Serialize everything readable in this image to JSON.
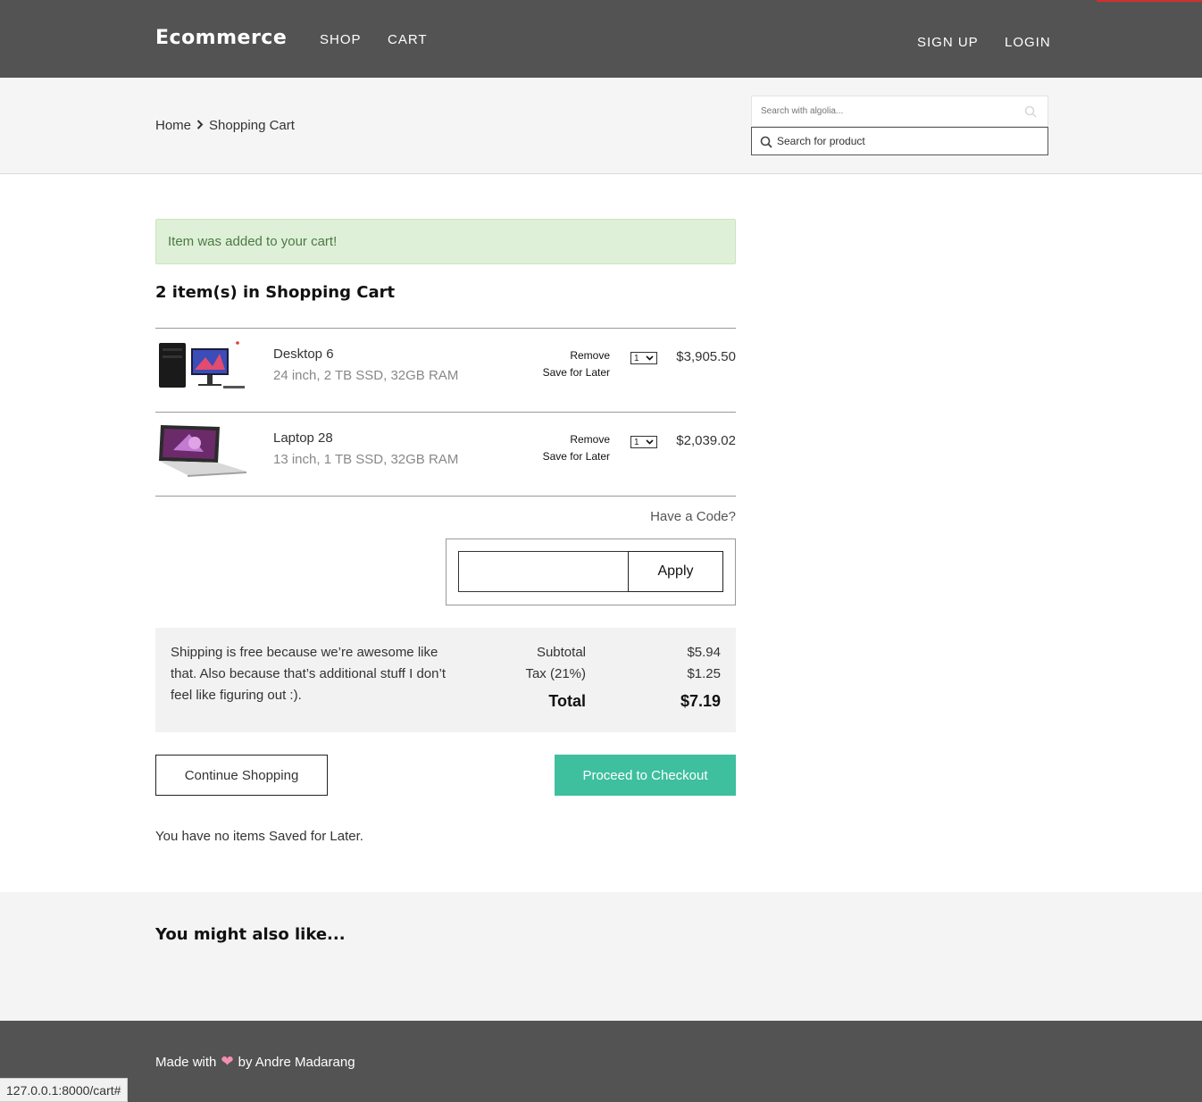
{
  "header": {
    "brand": "Ecommerce",
    "nav": {
      "shop": "SHOP",
      "cart": "CART",
      "signup": "SIGN UP",
      "login": "LOGIN"
    }
  },
  "breadcrumb": {
    "home": "Home",
    "current": "Shopping Cart"
  },
  "search": {
    "algolia_placeholder": "Search with algolia...",
    "product_placeholder": "Search for product"
  },
  "alert": "Item was added to your cart!",
  "cart": {
    "heading": "2 item(s) in Shopping Cart",
    "items": [
      {
        "name": "Desktop 6",
        "details": "24 inch, 2 TB SSD, 32GB RAM",
        "remove": "Remove",
        "save_for_later": "Save for Later",
        "qty": "1",
        "price": "$3,905.50"
      },
      {
        "name": "Laptop 28",
        "details": "13 inch, 1 TB SSD, 32GB RAM",
        "remove": "Remove",
        "save_for_later": "Save for Later",
        "qty": "1",
        "price": "$2,039.02"
      }
    ]
  },
  "coupon": {
    "prompt": "Have a Code?",
    "value": "",
    "apply": "Apply"
  },
  "totals": {
    "note": "Shipping is free because we’re awesome like that. Also because that’s additional stuff I don’t feel like figuring out :).",
    "subtotal_label": "Subtotal",
    "subtotal": "$5.94",
    "tax_label": "Tax (21%)",
    "tax": "$1.25",
    "total_label": "Total",
    "total": "$7.19"
  },
  "actions": {
    "continue": "Continue Shopping",
    "checkout": "Proceed to Checkout"
  },
  "saved_for_later": "You have no items Saved for Later.",
  "also_like": "You might also like...",
  "footer": {
    "made_with": "Made with",
    "heart": "❤",
    "by": "by Andre Madarang"
  },
  "status_url": "127.0.0.1:8000/cart#",
  "colors": {
    "header_bg": "#535353",
    "checkout": "#3ebf9e",
    "alert_bg": "#dff0d8",
    "accent": "#d32f2f"
  }
}
